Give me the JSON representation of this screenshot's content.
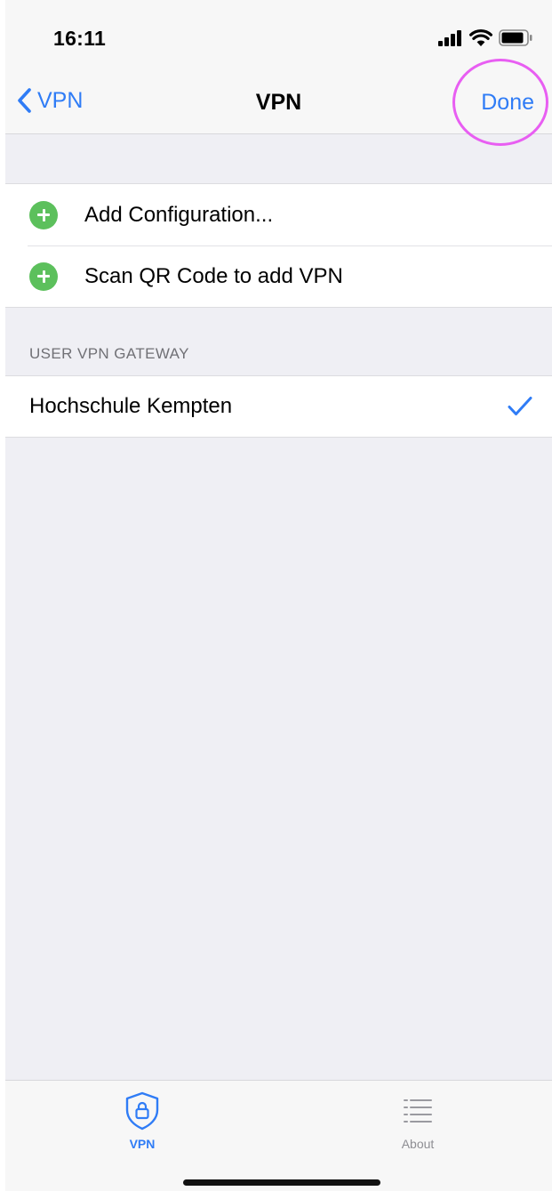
{
  "status_bar": {
    "time": "16:11"
  },
  "nav": {
    "back_label": "VPN",
    "title": "VPN",
    "done_label": "Done"
  },
  "add_section": {
    "items": [
      {
        "label": "Add Configuration...",
        "icon": "plus-circle-icon"
      },
      {
        "label": "Scan QR Code to add VPN",
        "icon": "plus-circle-icon"
      }
    ]
  },
  "gateway_section": {
    "header": "USER VPN GATEWAY",
    "items": [
      {
        "label": "Hochschule Kempten",
        "selected": true
      }
    ]
  },
  "tab_bar": {
    "tabs": [
      {
        "label": "VPN",
        "icon": "shield-lock-icon",
        "active": true
      },
      {
        "label": "About",
        "icon": "list-icon",
        "active": false
      }
    ]
  },
  "colors": {
    "accent": "#2f7cf6",
    "plus_green": "#5cc05c",
    "highlight": "#e85ef2",
    "background": "#efeff4"
  }
}
